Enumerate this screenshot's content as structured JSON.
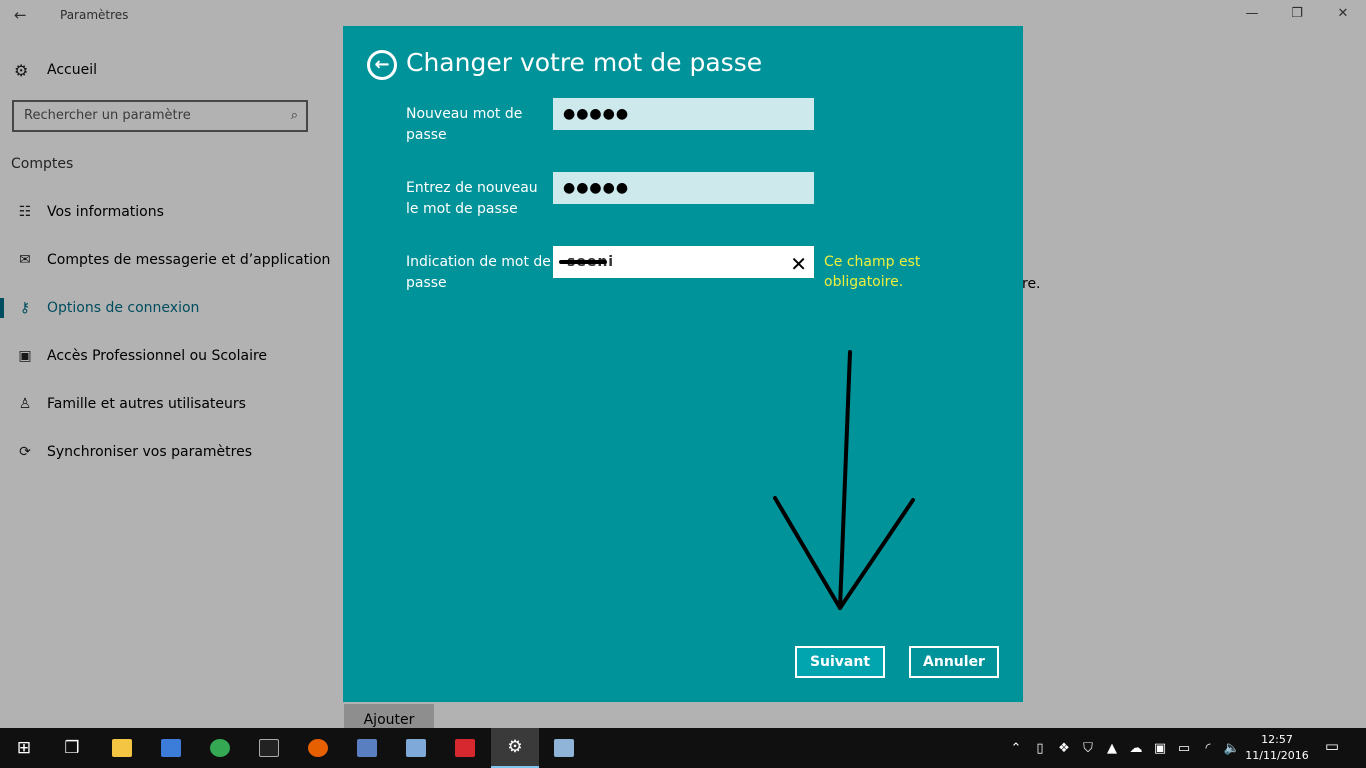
{
  "window": {
    "title": "Paramètres",
    "back_icon": "←",
    "min_icon": "—",
    "max_icon": "❐",
    "close_icon": "✕"
  },
  "sidebar": {
    "home": {
      "icon": "gear-icon",
      "glyph": "⚙",
      "label": "Accueil"
    },
    "search": {
      "placeholder": "Rechercher un paramètre",
      "icon": "search-icon",
      "glyph": "⌕"
    },
    "section": "Comptes",
    "items": [
      {
        "name": "sidebar-item-vos-informations",
        "icon": "person-list-icon",
        "glyph": "☷",
        "label": "Vos informations"
      },
      {
        "name": "sidebar-item-comptes-messagerie",
        "icon": "mail-icon",
        "glyph": "✉",
        "label": "Comptes de messagerie et d’application"
      },
      {
        "name": "sidebar-item-options-connexion",
        "icon": "key-icon",
        "glyph": "⚷",
        "label": "Options de connexion",
        "active": true
      },
      {
        "name": "sidebar-item-acces-professionnel",
        "icon": "briefcase-icon",
        "glyph": "▣",
        "label": "Accès Professionnel ou Scolaire"
      },
      {
        "name": "sidebar-item-famille",
        "icon": "person-icon",
        "glyph": "♙",
        "label": "Famille et autres utilisateurs"
      },
      {
        "name": "sidebar-item-synchroniser",
        "icon": "sync-icon",
        "glyph": "⟳",
        "label": "Synchroniser vos paramètres"
      }
    ]
  },
  "background": {
    "partial_text": "re.",
    "add_button": "Ajouter"
  },
  "dialog": {
    "back_glyph": "←",
    "title": "Changer votre mot de passe",
    "fields": [
      {
        "label": "Nouveau mot de passe",
        "value": "●●●●●"
      },
      {
        "label": "Entrez de nouveau le mot de passe",
        "value": "●●●●●"
      },
      {
        "label": "Indication de mot de passe",
        "value": "seeni",
        "clear_glyph": "✕"
      }
    ],
    "error": "Ce champ est obligatoire.",
    "buttons": {
      "next": "Suivant",
      "cancel": "Annuler"
    },
    "annotation_color": "#000000",
    "bg_color": "#00939a"
  },
  "taskbar": {
    "apps": [
      {
        "name": "start-button",
        "icon": "windows-logo-icon",
        "glyph": "⊞"
      },
      {
        "name": "task-view-button",
        "icon": "task-view-icon",
        "glyph": "❒"
      },
      {
        "name": "taskbar-file-explorer",
        "icon": "folder-icon",
        "color": "#f4c542"
      },
      {
        "name": "taskbar-app-2",
        "icon": "computer-icon",
        "color": "#3b7dd8"
      },
      {
        "name": "taskbar-chrome",
        "icon": "chrome-icon",
        "color": "#34a853"
      },
      {
        "name": "taskbar-cmd",
        "icon": "terminal-icon",
        "color": "#222222"
      },
      {
        "name": "taskbar-firefox",
        "icon": "firefox-icon",
        "color": "#e66000"
      },
      {
        "name": "taskbar-app-7",
        "icon": "monitor-icon",
        "color": "#5a7fc0"
      },
      {
        "name": "taskbar-virtualbox",
        "icon": "cube-icon",
        "color": "#7fa9d8"
      },
      {
        "name": "taskbar-creative-cloud",
        "icon": "creative-cloud-icon",
        "color": "#d7282f"
      },
      {
        "name": "taskbar-settings",
        "icon": "gear-icon",
        "glyph": "⚙",
        "active": true
      },
      {
        "name": "taskbar-app-11",
        "icon": "document-icon",
        "color": "#8fb4d8"
      }
    ],
    "tray": [
      {
        "name": "tray-chevron-icon",
        "glyph": "⌃"
      },
      {
        "name": "tray-usb-icon",
        "glyph": "▯"
      },
      {
        "name": "tray-dropbox-icon",
        "glyph": "❖"
      },
      {
        "name": "tray-shield-icon",
        "glyph": "⛉"
      },
      {
        "name": "tray-drive-icon",
        "glyph": "▲"
      },
      {
        "name": "tray-cloud-icon",
        "glyph": "☁"
      },
      {
        "name": "tray-app-icon",
        "glyph": "▣"
      },
      {
        "name": "tray-battery-icon",
        "glyph": "▭"
      },
      {
        "name": "tray-wifi-icon",
        "glyph": "◜"
      },
      {
        "name": "tray-volume-icon",
        "glyph": "🔈"
      }
    ],
    "time": "12:57",
    "date": "11/11/2016",
    "notification_glyph": "▭"
  }
}
